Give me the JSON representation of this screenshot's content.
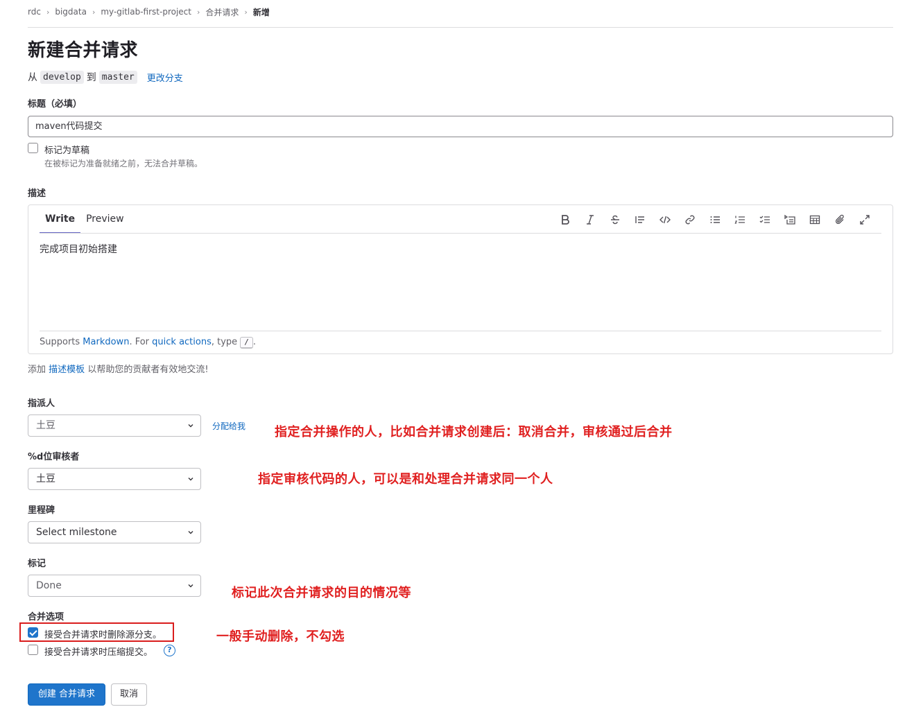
{
  "breadcrumb": [
    "rdc",
    "bigdata",
    "my-gitlab-first-project",
    "合并请求",
    "新增"
  ],
  "page_title": "新建合并请求",
  "branches": {
    "from_text": "从",
    "source": "develop",
    "to_text": "到",
    "target": "master",
    "change_link": "更改分支"
  },
  "title_field": {
    "label": "标题（必填）",
    "value": "maven代码提交"
  },
  "draft": {
    "label": "标记为草稿",
    "help": "在被标记为准备就绪之前，无法合并草稿。",
    "checked": false
  },
  "description": {
    "label": "描述",
    "tabs": [
      "Write",
      "Preview"
    ],
    "active_tab": "Write",
    "toolbar_icons": [
      "bold-icon",
      "italic-icon",
      "strikethrough-icon",
      "quote-icon",
      "code-icon",
      "link-icon",
      "bullet-list-icon",
      "numbered-list-icon",
      "task-list-icon",
      "collapsible-section-icon",
      "table-icon",
      "attach-file-icon",
      "fullscreen-icon"
    ],
    "value": "完成项目初始搭建",
    "footer": {
      "supports": "Supports ",
      "markdown": "Markdown",
      "for": ". For ",
      "quick_actions": "quick actions",
      "type": ", type ",
      "key": "/",
      "end": "."
    }
  },
  "template_line": {
    "prefix": "添加",
    "link": "描述模板",
    "suffix": "以帮助您的贡献者有效地交流!"
  },
  "assignee": {
    "label": "指派人",
    "value": "土豆",
    "assign_me": "分配给我"
  },
  "reviewer": {
    "label": "%d位审核者",
    "value": "土豆"
  },
  "milestone": {
    "label": "里程碑",
    "value": "Select milestone"
  },
  "labels": {
    "label": "标记",
    "value": "Done"
  },
  "merge_options": {
    "label": "合并选项",
    "delete_source": {
      "label": "接受合并请求时删除源分支。",
      "checked": true
    },
    "squash": {
      "label": "接受合并请求时压缩提交。",
      "checked": false
    },
    "help_glyph": "?"
  },
  "annotations": {
    "assignee_note": "指定合并操作的人，比如合并请求创建后：取消合并，审核通过后合并",
    "reviewer_note": "指定审核代码的人，可以是和处理合并请求同一个人",
    "labels_note": "标记此次合并请求的目的情况等",
    "delete_note": "一般手动删除，不勾选",
    "color": "#e02020"
  },
  "actions": {
    "create": "创建 合并请求",
    "cancel": "取消"
  },
  "colors": {
    "primary": "#1f75cb",
    "link": "#1068bf",
    "annotation_red": "#e02020"
  }
}
